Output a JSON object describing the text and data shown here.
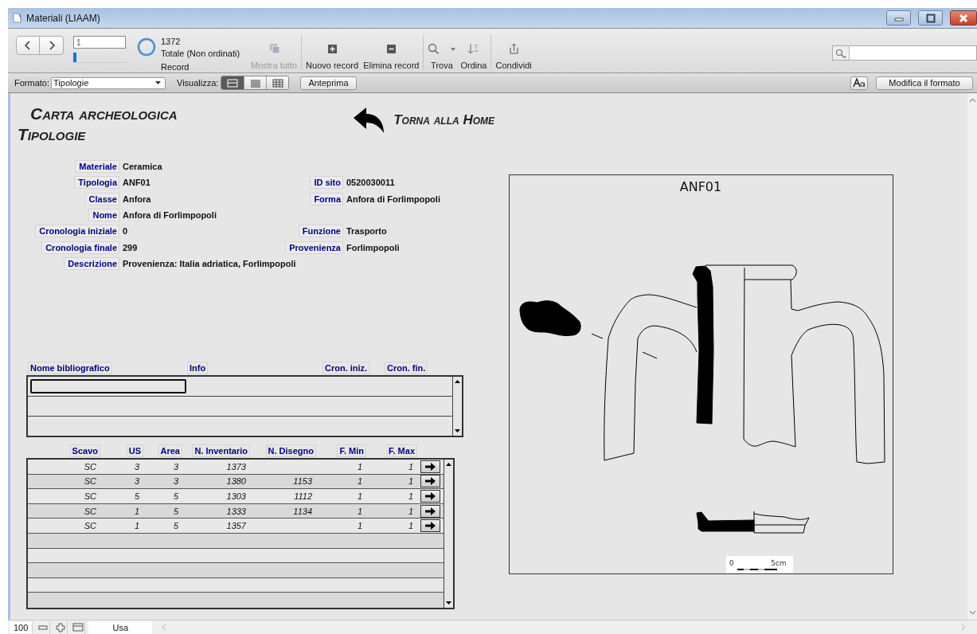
{
  "window": {
    "title": "Materiali (LIAAM)"
  },
  "toolbar": {
    "record_number": "1",
    "record_slider": {
      "level": 0
    },
    "found_count": "1372",
    "found_status": "Totale (Non ordinati)",
    "found_unit": "Record",
    "buttons": [
      {
        "kind": "show_all",
        "label": "Mostra tutto",
        "disabled": true
      },
      {
        "kind": "new",
        "label": "Nuovo record",
        "disabled": false
      },
      {
        "kind": "delete",
        "label": "Elimina record",
        "disabled": false
      },
      {
        "kind": "find",
        "label": "Trova",
        "disabled": false
      },
      {
        "kind": "sort",
        "label": "Ordina",
        "disabled": false
      },
      {
        "kind": "share",
        "label": "Condividi",
        "disabled": false
      }
    ]
  },
  "layout_bar": {
    "layout_label": "Formato:",
    "layout_value": "Tipologie",
    "view_label": "Visualizza:",
    "views": [
      {
        "kind": "form",
        "selected": true
      },
      {
        "kind": "list",
        "selected": false
      },
      {
        "kind": "table",
        "selected": false
      }
    ],
    "preview_button": "Anteprima",
    "edit_layout_button": "Modifica il formato"
  },
  "form": {
    "title": "Carta archeologica",
    "subtitle": "Tipologie",
    "home_link": "Torna alla Home",
    "fields": [
      {
        "left": {
          "label": "Materiale",
          "value": "Ceramica"
        }
      },
      {
        "left": {
          "label": "Tipologia",
          "value": "ANF01"
        },
        "right": {
          "label": "ID sito",
          "value": "0520030011"
        }
      },
      {
        "left": {
          "label": "Classe",
          "value": "Anfora"
        },
        "right": {
          "label": "Forma",
          "value": "Anfora di Forlimpopoli"
        }
      },
      {
        "left": {
          "label": "Nome",
          "value": "Anfora di Forlimpopoli"
        }
      },
      {
        "left": {
          "label": "Cronologia iniziale",
          "value": "0"
        },
        "right": {
          "label": "Funzione",
          "value": "Trasporto"
        }
      },
      {
        "left": {
          "label": "Cronologia finale",
          "value": "299"
        },
        "right": {
          "label": "Provenienza",
          "value": "Forlimpopoli"
        }
      },
      {
        "left": {
          "label": "Descrizione",
          "value": "Provenienza: Italia adriatica, Forlimpopoli"
        }
      }
    ],
    "bibliography": {
      "columns": [
        "Nome bibliografico",
        "Info",
        "Cron. iniz.",
        "Cron. fin."
      ]
    },
    "finds": {
      "columns": [
        "Scavo",
        "US",
        "Area",
        "N. Inventario",
        "N. Disegno",
        "F. Min",
        "F. Max"
      ],
      "rows": [
        {
          "scavo": "SC",
          "us": "3",
          "area": "3",
          "n_inventario": "1373",
          "f_min": "1",
          "f_max": "1"
        },
        {
          "scavo": "SC",
          "us": "3",
          "area": "3",
          "n_inventario": "1380",
          "n_disegno": "1153",
          "f_min": "1",
          "f_max": "1"
        },
        {
          "scavo": "SC",
          "us": "5",
          "area": "5",
          "n_inventario": "1303",
          "n_disegno": "1112",
          "f_min": "1",
          "f_max": "1"
        },
        {
          "scavo": "SC",
          "us": "1",
          "area": "5",
          "n_inventario": "1333",
          "n_disegno": "1134",
          "f_min": "1",
          "f_max": "1"
        },
        {
          "scavo": "SC",
          "us": "1",
          "area": "5",
          "n_inventario": "1357",
          "f_min": "1",
          "f_max": "1"
        }
      ]
    },
    "drawing": {
      "title": "ANF01",
      "scale_start": "0",
      "scale_end": "5cm"
    }
  },
  "status_bar": {
    "zoom": "100",
    "mode": "Usa"
  }
}
